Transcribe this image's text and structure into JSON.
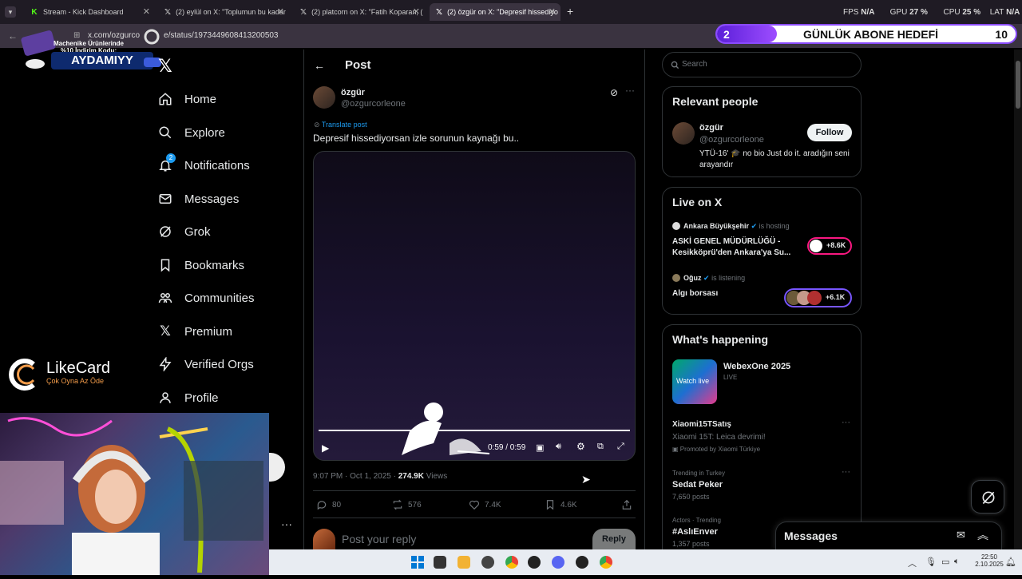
{
  "browser": {
    "tabs": [
      {
        "title": "Stream - Kick Dashboard",
        "icon": "kick-icon"
      },
      {
        "title": "(2) eylül on X: \"Toplumun bu kadar",
        "icon": "x-icon"
      },
      {
        "title": "(2) platcorn on X: \"Fatih Koparan, (",
        "icon": "x-icon"
      },
      {
        "title": "(2) özgür on X: \"Depresif hissediyo",
        "icon": "x-icon"
      }
    ],
    "new_tab": "+",
    "url": "x.com/ozgurcorleone/status/1973449608413200503",
    "url_visible": "x.com/ozgurco",
    "url_tail": "e/status/1973449608413200503",
    "stats": {
      "fps_label": "FPS",
      "fps": "N/A",
      "gpu_label": "GPU",
      "gpu": "27 %",
      "cpu_label": "CPU",
      "cpu": "25 %",
      "lat_label": "LAT",
      "lat": "N/A"
    }
  },
  "overlay": {
    "promo_line": "Machenike Ürünlerinde %10 İndirim Kodu:",
    "promo_code": "AYDAMIYY",
    "sub_goal_current": "2",
    "sub_goal_title": "GÜNLÜK ABONE HEDEFİ",
    "sub_goal_target": "10",
    "sub_goal_progress": 0.2,
    "likecard_name": "LikeCard",
    "likecard_tagline": "Çok Oyna  Az Öde"
  },
  "nav": {
    "items": [
      {
        "label": "Home",
        "icon": "home-icon"
      },
      {
        "label": "Explore",
        "icon": "search-icon"
      },
      {
        "label": "Notifications",
        "icon": "bell-icon",
        "badge": "2"
      },
      {
        "label": "Messages",
        "icon": "envelope-icon"
      },
      {
        "label": "Grok",
        "icon": "grok-icon"
      },
      {
        "label": "Bookmarks",
        "icon": "bookmark-icon"
      },
      {
        "label": "Communities",
        "icon": "communities-icon"
      },
      {
        "label": "Premium",
        "icon": "x-icon"
      },
      {
        "label": "Verified Orgs",
        "icon": "lightning-icon"
      },
      {
        "label": "Profile",
        "icon": "person-icon"
      }
    ]
  },
  "post": {
    "header_title": "Post",
    "author_name": "özgür",
    "author_handle": "@ozgurcorleone",
    "translate": "Translate post",
    "text": "Depresif hissediyorsan izle sorunun kaynağı bu..",
    "video_time": "0:59 / 0:59",
    "video_progress": 1.0,
    "timestamp": "9:07 PM · Oct 1, 2025 · ",
    "views": "274.9K",
    "views_label": " Views",
    "replies": "80",
    "reposts": "576",
    "likes": "7.4K",
    "bookmarks": "4.6K",
    "reply_placeholder": "Post your reply",
    "reply_button": "Reply"
  },
  "sidebar": {
    "search_placeholder": "Search",
    "relevant_title": "Relevant people",
    "relevant_name": "özgür",
    "relevant_handle": "@ozgurcorleone",
    "relevant_bio": "YTÜ-16' 🎓 no bio Just do it. aradığın seni arayandır",
    "follow": "Follow",
    "live_title": "Live on X",
    "live1_host": "Ankara Büyükşehir",
    "live1_status": "is hosting",
    "live1_title": "ASKİ GENEL MÜDÜRLÜĞÜ - Kesikköprü'den Ankara'ya Su...",
    "live1_count": "+8.6K",
    "live2_host": "Oğuz",
    "live2_status": "is listening",
    "live2_title": "Algı borsası",
    "live2_count": "+6.1K",
    "happening_title": "What's happening",
    "event_title": "WebexOne 2025",
    "event_status": "LIVE",
    "event_thumb_text": "Watch live",
    "promo_tag": "Xiaomi15TSatış",
    "promo_desc": "Xiaomi 15T: Leica devrimi!",
    "promo_by": "Promoted by Xiaomi Türkiye",
    "trend1_context": "Trending in Turkey",
    "trend1_name": "Sedat Peker",
    "trend1_count": "7,650 posts",
    "trend2_context": "Actors · Trending",
    "trend2_name": "#AslıEnver",
    "trend2_count": "1,357 posts",
    "messages_dock": "Messages"
  },
  "taskbar": {
    "time": "22:50",
    "date": "2.10.2025"
  },
  "colors": {
    "accent": "#1d9bf0",
    "sub_goal_purple": "#8a4bff",
    "live_pink": "#f91880",
    "live_purple": "#7856ff"
  }
}
